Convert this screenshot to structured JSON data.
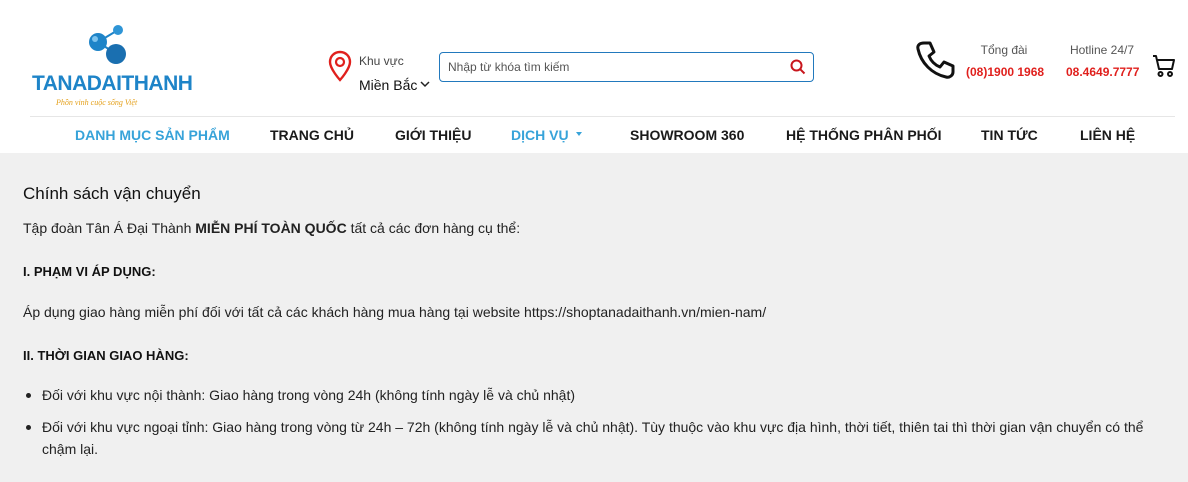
{
  "brand": {
    "logo_text_1": "TANA",
    "logo_text_2": "DAITHANH",
    "slogan": "Phồn vinh cuộc sống Việt",
    "colors": {
      "primary": "#1e84c8",
      "accent": "#f3a21a",
      "hotline_red": "#e0201d",
      "nav_active": "#37a3d9"
    }
  },
  "header": {
    "region_label": "Khu vực",
    "region_value": "Miền Bắc",
    "search_placeholder": "Nhập từ khóa tìm kiếm",
    "switchboard_label": "Tổng đài",
    "switchboard_number": "(08)1900 1968",
    "hotline_label": "Hotline 24/7",
    "hotline_number": "08.4649.7777",
    "icons": [
      "location-pin-icon",
      "chevron-down-icon",
      "search-icon",
      "phone-icon",
      "cart-icon"
    ]
  },
  "nav": {
    "items": [
      {
        "label": "DANH MỤC SẢN PHẨM"
      },
      {
        "label": "TRANG CHỦ"
      },
      {
        "label": "GIỚI THIỆU"
      },
      {
        "label": "DỊCH VỤ"
      },
      {
        "label": "SHOWROOM 360"
      },
      {
        "label": "HỆ THỐNG PHÂN PHỐI"
      },
      {
        "label": "TIN TỨC"
      },
      {
        "label": "LIÊN HỆ"
      }
    ]
  },
  "content": {
    "title": "Chính sách vận chuyển",
    "intro_prefix": "Tập đoàn Tân Á Đại Thành ",
    "intro_bold": "MIỄN PHÍ TOÀN QUỐC",
    "intro_suffix": " tất cả các đơn hàng cụ thể:",
    "section1_heading": "I. PHẠM VI ÁP DỤNG:",
    "section1_text": "Áp dụng giao hàng miễn phí đối với tất cả các khách hàng mua hàng tại website https://shoptanadaithanh.vn/mien-nam/",
    "section2_heading": "II. THỜI GIAN GIAO HÀNG:",
    "bullets": [
      "Đối với khu vực nội thành: Giao hàng trong vòng 24h (không tính ngày lễ và chủ nhật)",
      "Đối với khu vực ngoại tỉnh: Giao hàng trong vòng từ 24h – 72h (không tính ngày lễ và chủ nhật). Tùy thuộc vào khu vực địa hình, thời tiết, thiên tai thì thời gian vận chuyển có thể chậm lại."
    ]
  }
}
